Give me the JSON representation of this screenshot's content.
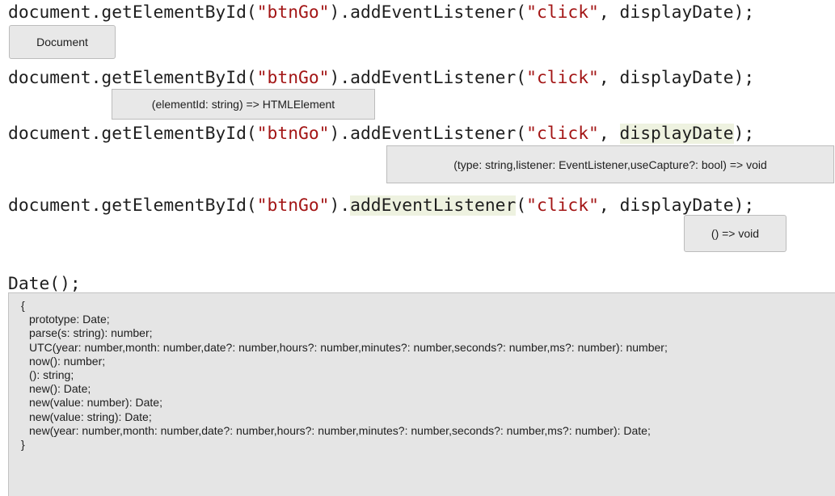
{
  "examples": [
    {
      "code": {
        "p1": "document.getElementById(",
        "p2": "\"btnGo\"",
        "p3": ").addEventListener(",
        "p4": "\"click\"",
        "p5": ", ",
        "p6": "displayDate",
        "p7": ");"
      },
      "tooltip": "Document"
    },
    {
      "code": {
        "p1": "document.getElementById(",
        "p2": "\"btnGo\"",
        "p3": ").addEventListener(",
        "p4": "\"click\"",
        "p5": ", ",
        "p6": "displayDate",
        "p7": ");"
      },
      "tooltip": "(elementId: string) => HTMLElement"
    },
    {
      "code": {
        "p1": "document.getElementById(",
        "p2": "\"btnGo\"",
        "p3": ").addEventListener(",
        "p4": "\"click\"",
        "p5": ", ",
        "p6": "displayDate",
        "p7": ");"
      },
      "highlighted_token": "displayDate",
      "tooltip": "(type: string,listener: EventListener,useCapture?: bool) => void"
    },
    {
      "code": {
        "p1": "document.getElementById(",
        "p2": "\"btnGo\"",
        "p3": ").",
        "p3b": "addEventListener",
        "p3c": "(",
        "p4": "\"click\"",
        "p5": ", ",
        "p6": "displayDate",
        "p7": ");"
      },
      "highlighted_token": "addEventListener",
      "tooltip": "() => void"
    }
  ],
  "date_call": "Date();",
  "date_signature": {
    "open": "{",
    "members": [
      "prototype: Date;",
      "parse(s: string): number;",
      "UTC(year: number,month: number,date?: number,hours?: number,minutes?: number,seconds?: number,ms?: number): number;",
      "now(): number;",
      "(): string;",
      "new(): Date;",
      "new(value: number): Date;",
      "new(value: string): Date;",
      "new(year: number,month: number,date?: number,hours?: number,minutes?: number,seconds?: number,ms?: number): Date;"
    ],
    "close": "}"
  },
  "colors": {
    "code_text": "#1e1e1e",
    "string_literal": "#a31515",
    "token_highlight": "#eef2e0",
    "tooltip_background": "#e8e8e8",
    "tooltip_border": "#bcbcbc"
  }
}
